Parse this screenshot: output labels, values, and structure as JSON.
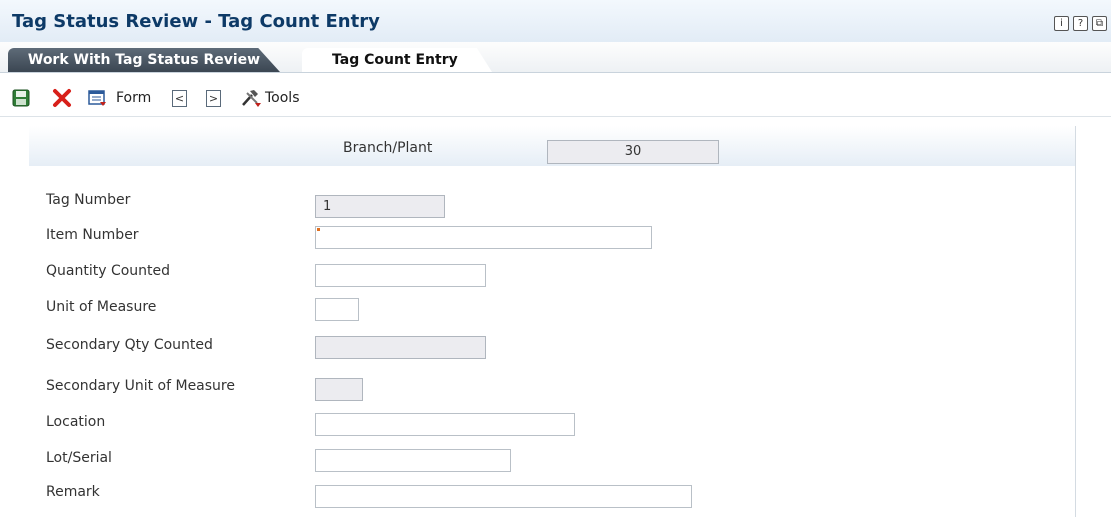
{
  "window": {
    "title": "Tag Status Review - Tag Count Entry",
    "icons": [
      {
        "name": "info-icon",
        "glyph": "i"
      },
      {
        "name": "help-icon",
        "glyph": "?"
      },
      {
        "name": "window-icon",
        "glyph": "⧉"
      }
    ]
  },
  "tabs": [
    {
      "label": "Work With Tag Status Review",
      "active": false
    },
    {
      "label": "Tag Count Entry",
      "active": true
    }
  ],
  "toolbar": {
    "save_icon": "save-icon",
    "cancel_icon": "cancel-icon",
    "form_label": "Form",
    "prev_glyph": "<",
    "next_glyph": ">",
    "tools_label": "Tools"
  },
  "form": {
    "branch_plant": {
      "label": "Branch/Plant",
      "value": "30"
    },
    "tag_number": {
      "label": "Tag Number",
      "value": "1"
    },
    "item_number": {
      "label": "Item Number",
      "value": ""
    },
    "quantity_counted": {
      "label": "Quantity Counted",
      "value": ""
    },
    "unit_of_measure": {
      "label": "Unit of Measure",
      "value": ""
    },
    "secondary_qty_counted": {
      "label": "Secondary Qty Counted",
      "value": ""
    },
    "secondary_unit_of_measure": {
      "label": "Secondary Unit of Measure",
      "value": ""
    },
    "location": {
      "label": "Location",
      "value": ""
    },
    "lot_serial": {
      "label": "Lot/Serial",
      "value": ""
    },
    "remark": {
      "label": "Remark",
      "value": ""
    }
  },
  "colors": {
    "title": "#0d3a67",
    "tab_inactive": "#3b4652",
    "required_marker": "#e07020"
  }
}
